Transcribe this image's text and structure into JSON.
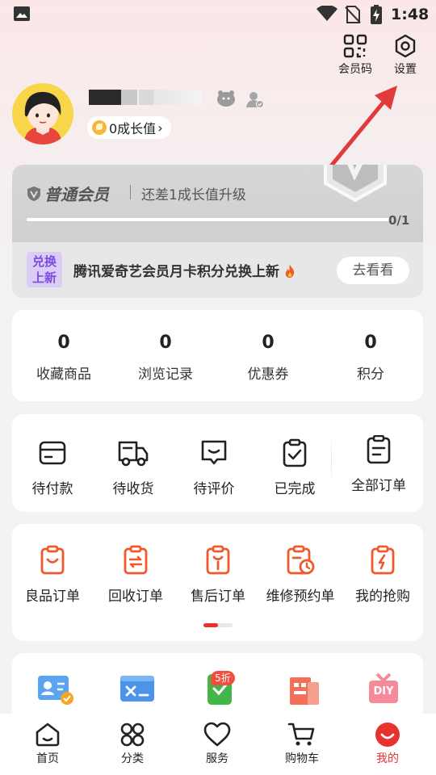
{
  "status_bar": {
    "time": "1:48"
  },
  "header": {
    "member_code_label": "会员码",
    "settings_label": "设置"
  },
  "profile": {
    "growth_value": "0成长值",
    "growth_chevron": "›"
  },
  "member_card": {
    "level": "普通会员",
    "upgrade_hint": "还差1成长值升级",
    "progress_text": "0/1",
    "progress_fraction": 0,
    "promo_tag_line1": "兑换",
    "promo_tag_line2": "上新",
    "promo_text": "腾讯爱奇艺会员月卡积分兑换上新",
    "promo_button": "去看看"
  },
  "stats": [
    {
      "value": "0",
      "label": "收藏商品"
    },
    {
      "value": "0",
      "label": "浏览记录"
    },
    {
      "value": "0",
      "label": "优惠券"
    },
    {
      "value": "0",
      "label": "积分"
    }
  ],
  "orders": {
    "items": [
      {
        "label": "待付款",
        "icon": "wallet-icon"
      },
      {
        "label": "待收货",
        "icon": "truck-icon"
      },
      {
        "label": "待评价",
        "icon": "comment-icon"
      },
      {
        "label": "已完成",
        "icon": "check-clipboard-icon"
      }
    ],
    "all_label": "全部订单"
  },
  "services": [
    {
      "label": "良品订单",
      "icon": "smile-clipboard-icon"
    },
    {
      "label": "回收订单",
      "icon": "recycle-clipboard-icon"
    },
    {
      "label": "售后订单",
      "icon": "wrench-clipboard-icon"
    },
    {
      "label": "维修预约单",
      "icon": "clock-clipboard-icon"
    },
    {
      "label": "我的抢购",
      "icon": "flash-clipboard-icon"
    }
  ],
  "tools": {
    "discount_badge": "5折",
    "diy_label": "DIY"
  },
  "tabbar": [
    {
      "label": "首页",
      "icon": "home-icon"
    },
    {
      "label": "分类",
      "icon": "category-icon"
    },
    {
      "label": "服务",
      "icon": "heart-icon"
    },
    {
      "label": "购物车",
      "icon": "cart-icon"
    },
    {
      "label": "我的",
      "icon": "profile-icon",
      "active": true
    }
  ],
  "colors": {
    "accent": "#e8322f",
    "orange": "#ee5a2c",
    "card_grey": "#d2d2d2"
  }
}
